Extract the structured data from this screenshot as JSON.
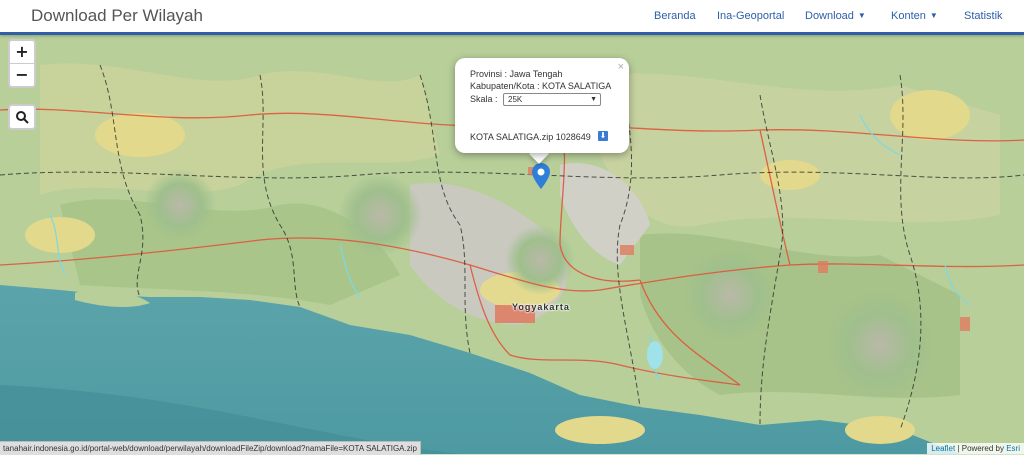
{
  "navbar": {
    "brand": "Download Per Wilayah",
    "items": [
      {
        "label": "Beranda"
      },
      {
        "label": "Ina-Geoportal"
      },
      {
        "label": "Download",
        "dropdown": true
      },
      {
        "label": "Konten",
        "dropdown": true
      },
      {
        "label": "Statistik"
      }
    ],
    "accent_color": "#2e5fa8"
  },
  "map_controls": {
    "zoom_in": "+",
    "zoom_out": "−",
    "search_icon": "search-icon"
  },
  "popup": {
    "provinsi": "Provinsi : Jawa Tengah",
    "kabupaten": "Kabupaten/Kota : KOTA SALATIGA",
    "skala_label": "Skala :",
    "skala_value": "25K",
    "file_text": "KOTA SALATIGA.zip 1028649",
    "close": "×",
    "download_icon": "download-icon"
  },
  "map": {
    "city_label": "Yogyakarta"
  },
  "status_url": "tanahair.indonesia.go.id/portal-web/download/perwilayah/downloadFileZip/download?namaFile=KOTA SALATIGA.zip",
  "attribution": {
    "leaflet": "Leaflet",
    "separator": " | Powered by ",
    "esri": "Esri"
  }
}
